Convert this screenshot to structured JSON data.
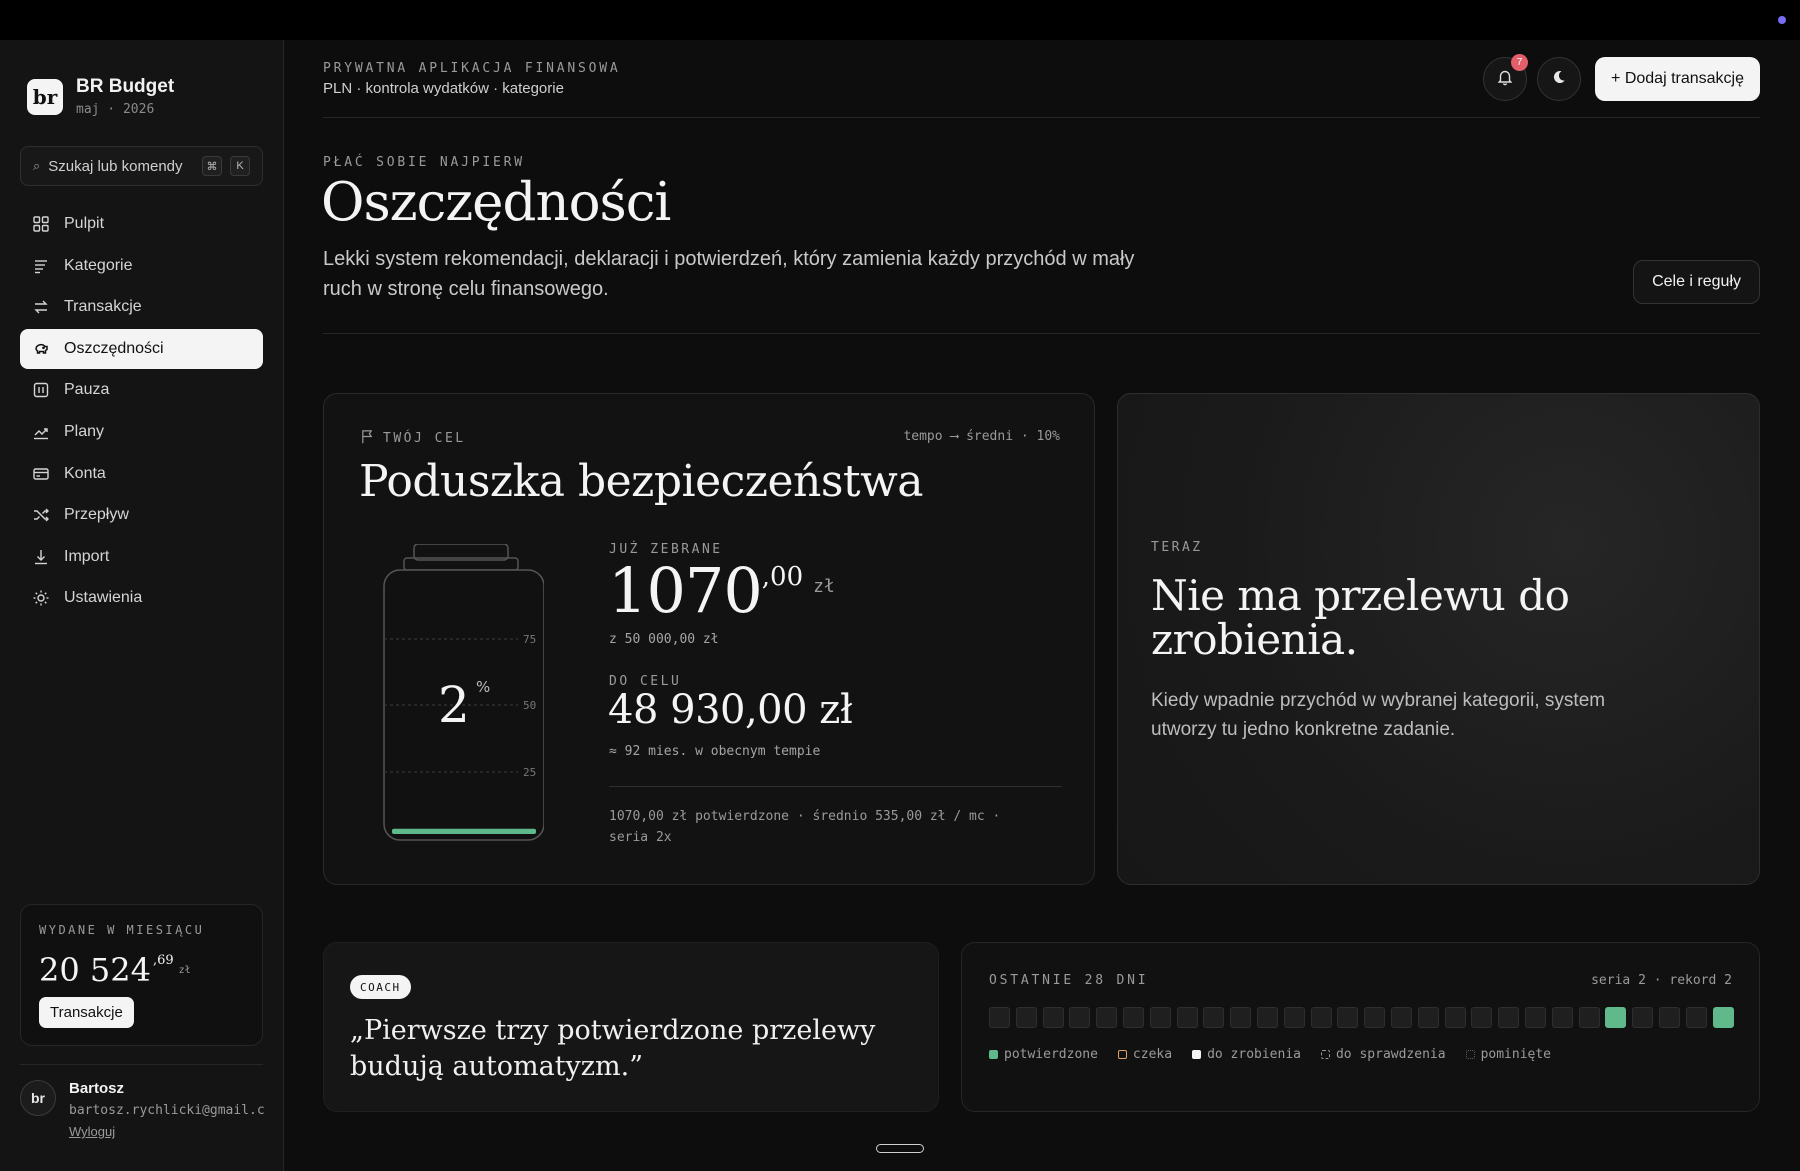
{
  "brand": {
    "logo": "br",
    "title": "BR Budget",
    "subtitle": "maj · 2026"
  },
  "search": {
    "label": "Szukaj lub komendy",
    "kbd1": "⌘",
    "kbd2": "K"
  },
  "nav": [
    {
      "label": "Pulpit",
      "icon": "grid-icon"
    },
    {
      "label": "Kategorie",
      "icon": "list-icon"
    },
    {
      "label": "Transakcje",
      "icon": "swap-icon"
    },
    {
      "label": "Oszczędności",
      "icon": "piggy-bank-icon",
      "active": true
    },
    {
      "label": "Pauza",
      "icon": "pause-icon"
    },
    {
      "label": "Plany",
      "icon": "trend-icon"
    },
    {
      "label": "Konta",
      "icon": "card-icon"
    },
    {
      "label": "Przepływ",
      "icon": "shuffle-icon"
    },
    {
      "label": "Import",
      "icon": "download-icon"
    },
    {
      "label": "Ustawienia",
      "icon": "sun-gear-icon"
    }
  ],
  "spent": {
    "label": "WYDANE W MIESIĄCU",
    "amount": "20 524",
    "decimals": ",69",
    "currency": "zł",
    "button": "Transakcje"
  },
  "user": {
    "avatar": "br",
    "name": "Bartosz",
    "email": "bartosz.rychlicki@gmail.com",
    "logout": "Wyloguj"
  },
  "header": {
    "label": "PRYWATNA APLIKACJA FINANSOWA",
    "sub": "PLN · kontrola wydatków · kategorie",
    "notifications": "7",
    "add_button": "+ Dodaj transakcję"
  },
  "page": {
    "kicker": "PŁAĆ SOBIE NAJPIERW",
    "title": "Oszczędności",
    "description": "Lekki system rekomendacji, deklaracji i potwierdzeń, który zamienia każdy przychód w mały ruch w stronę celu finansowego.",
    "rules_button": "Cele i reguły"
  },
  "goal": {
    "tag": "TWÓJ CEL",
    "tempo": "tempo ⟶ średni · 10%",
    "title": "Poduszka bezpieczeństwa",
    "percent": "2",
    "percent_sign": "%",
    "fill_fraction": 0.02,
    "ticks": [
      "75",
      "50",
      "25"
    ],
    "saved_label": "JUŻ ZEBRANE",
    "saved_int": "1070",
    "saved_dec": ",00",
    "saved_cur": "zł",
    "saved_of": "z 50 000,00 zł",
    "togo_label": "DO CELU",
    "togo_amount": "48 930,00 zł",
    "togo_note": "≈ 92 mies. w obecnym tempie",
    "footer": "1070,00 zł potwierdzone · średnio 535,00 zł / mc · seria 2x"
  },
  "now": {
    "label": "TERAZ",
    "title": "Nie ma przelewu do zrobienia.",
    "description": "Kiedy wpadnie przychód w wybranej kategorii, system utworzy tu jedno konkretne zadanie."
  },
  "coach": {
    "badge": "COACH",
    "quote": "„Pierwsze trzy potwierdzone przelewy budują automatyzm.”"
  },
  "days": {
    "label": "OSTATNIE 28 DNI",
    "streak": "seria 2 · rekord 2",
    "confirmed_days": [
      24,
      28
    ],
    "total": 28,
    "legend": [
      {
        "label": "potwierdzone",
        "color": "#5fb98a"
      },
      {
        "label": "czeka",
        "color": "#e0a060"
      },
      {
        "label": "do zrobienia",
        "color": "#f4f4f4"
      },
      {
        "label": "do sprawdzenia",
        "color": "#9a9a9a"
      },
      {
        "label": "pominięte",
        "color": "#5a5a5a"
      }
    ]
  }
}
